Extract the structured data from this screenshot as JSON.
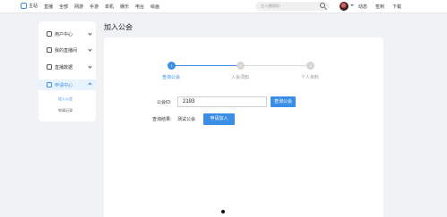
{
  "nav": {
    "home": "主站",
    "links": [
      "直播",
      "全部",
      "网游",
      "手游",
      "单机",
      "娱乐",
      "电台",
      "绘画"
    ],
    "search_placeholder": "主人想搜啥?",
    "user_links": [
      "动态",
      "签到",
      "下载"
    ]
  },
  "sidebar": {
    "items": [
      {
        "label": "用户中心",
        "icon": "user-icon"
      },
      {
        "label": "我的直播间",
        "icon": "tv-icon"
      },
      {
        "label": "直播数据",
        "icon": "chart-icon"
      },
      {
        "label": "申请中心",
        "icon": "apply-icon",
        "active": true
      }
    ],
    "subitems": [
      "加入公会",
      "申请记录"
    ]
  },
  "page": {
    "title": "加入公会",
    "steps": [
      {
        "num": "1",
        "label": "查询公会"
      },
      {
        "num": "2",
        "label": "入会须知"
      },
      {
        "num": "3",
        "label": "个人资料"
      }
    ],
    "guild_id_label": "公会ID:",
    "guild_id_value": "2193",
    "query_button": "查询公会",
    "result_label": "查询结果:",
    "result_value": "测试公会",
    "apply_button": "申请加入"
  },
  "colors": {
    "accent": "#3a8ee6"
  }
}
